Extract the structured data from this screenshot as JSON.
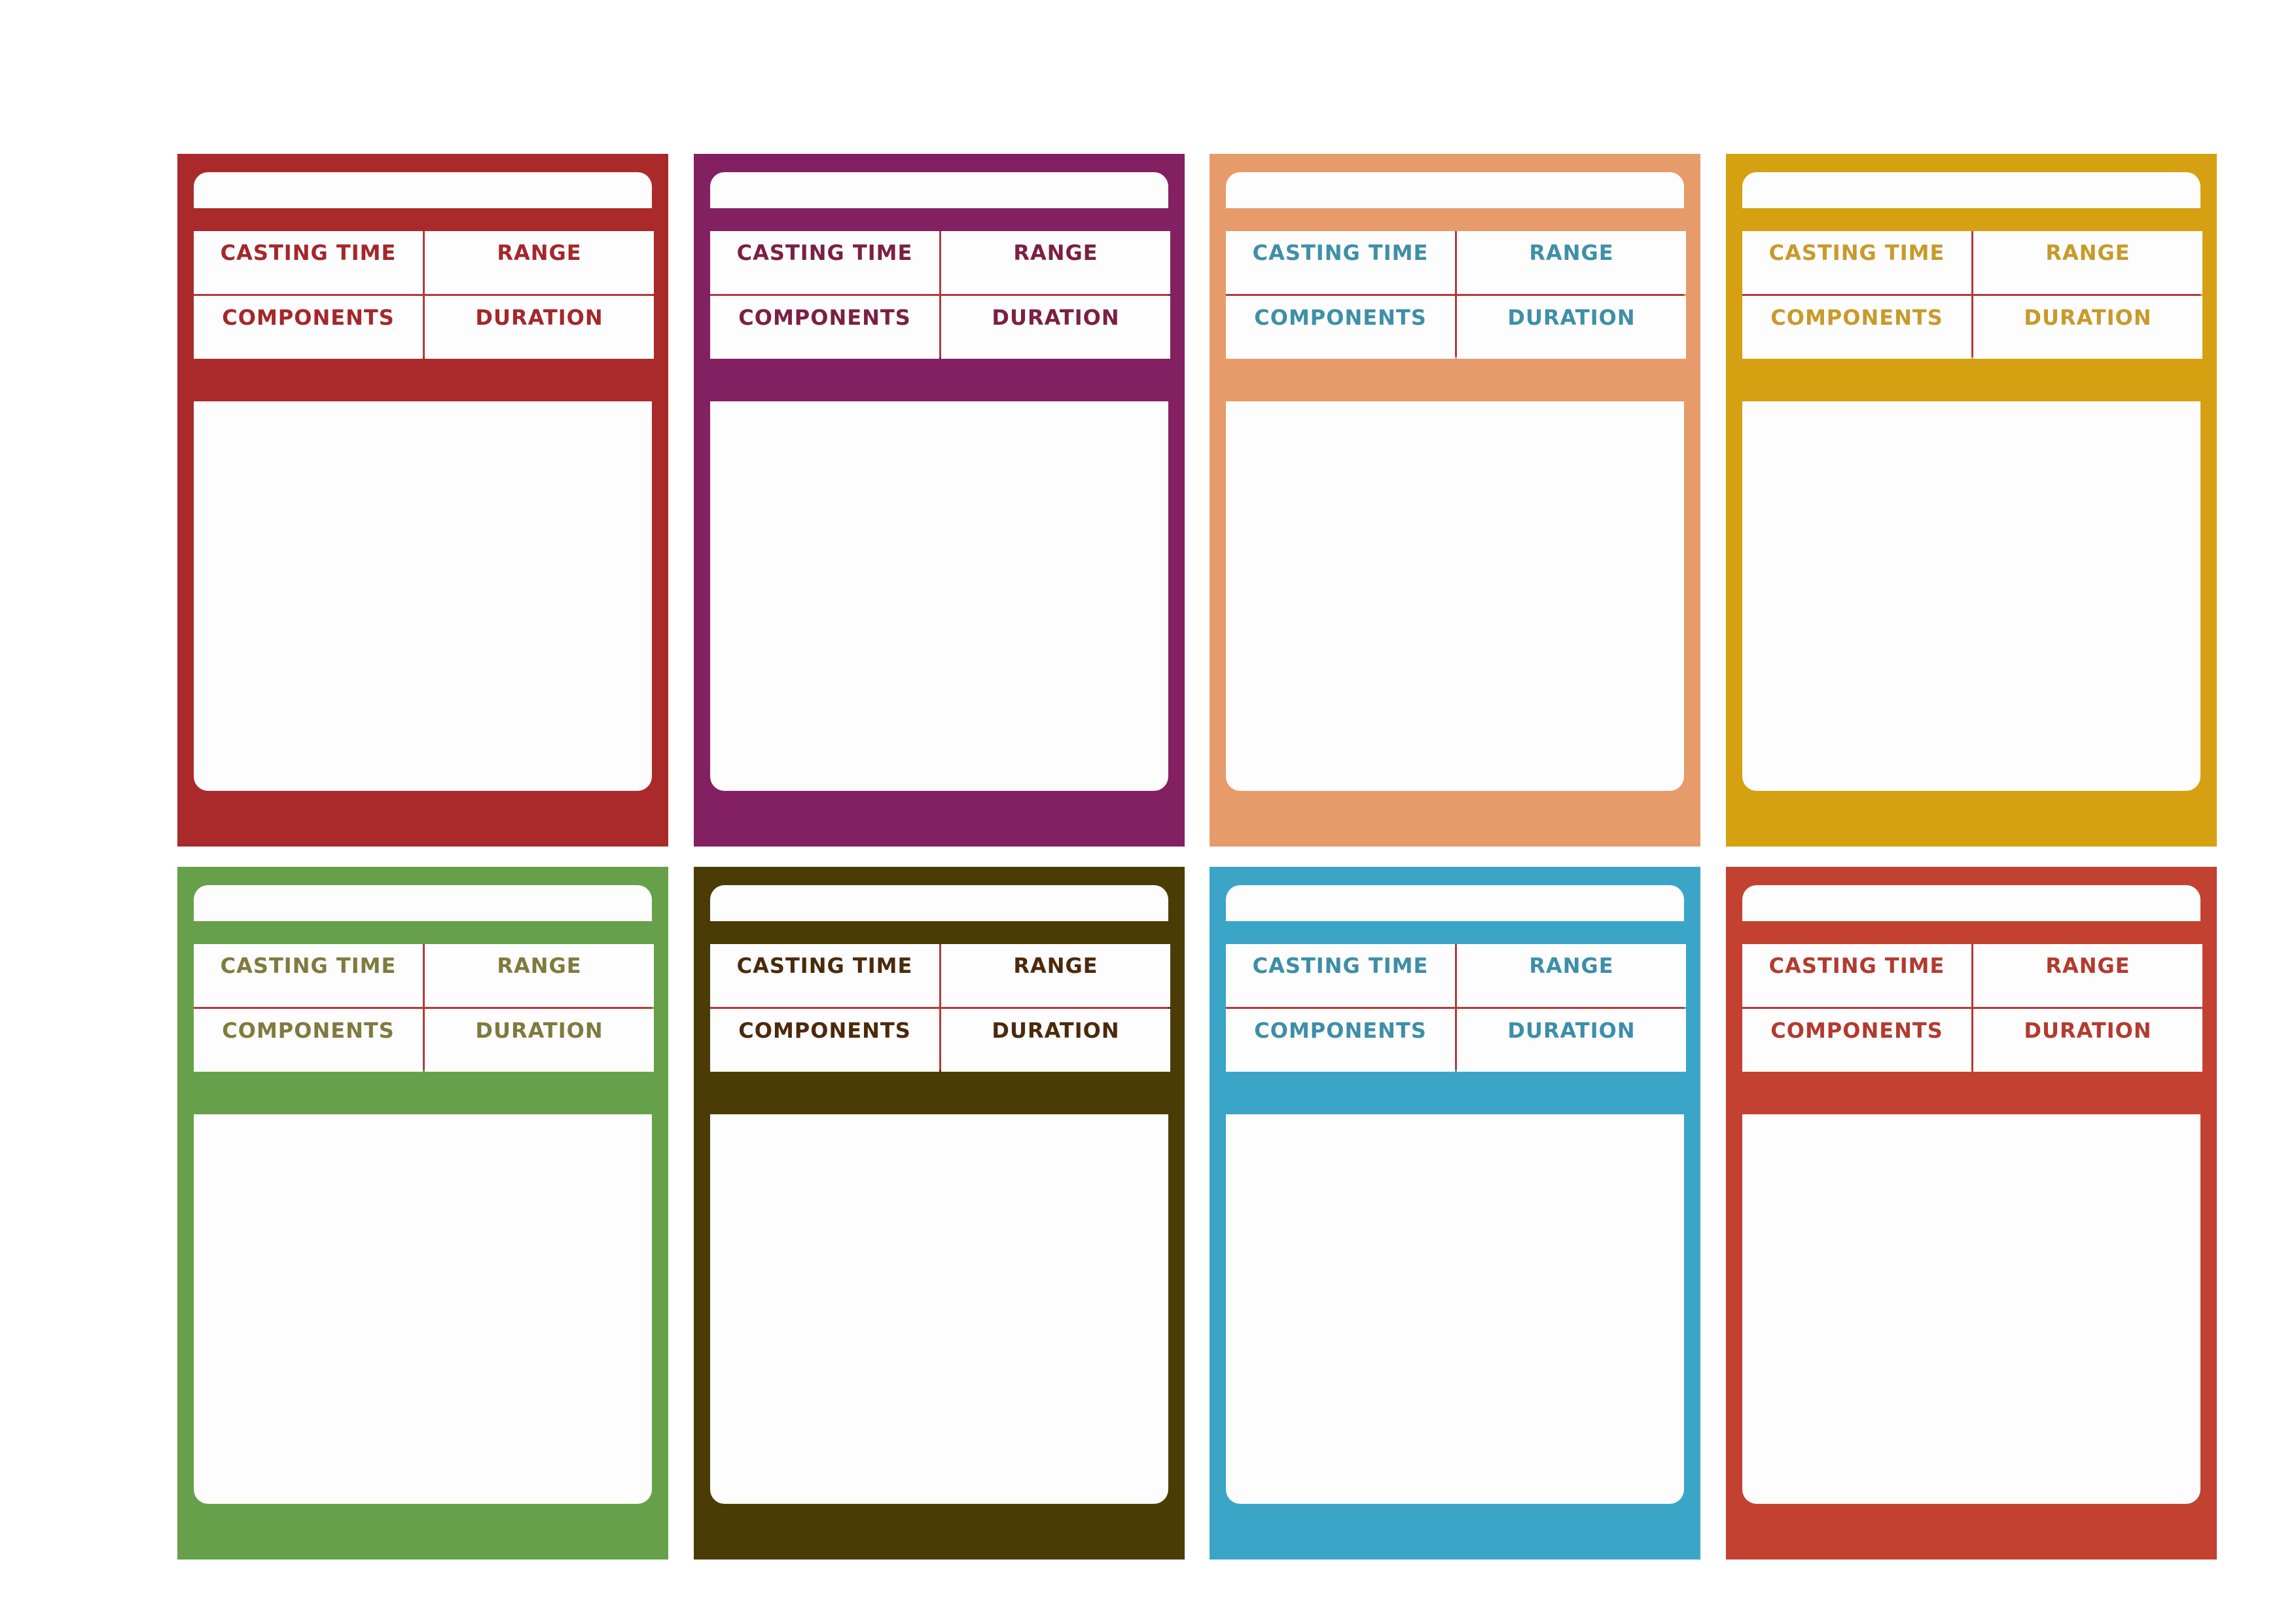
{
  "labels": {
    "casting_time": "CASTING TIME",
    "range": "RANGE",
    "components": "COMPONENTS",
    "duration": "DURATION"
  },
  "cards": [
    {
      "name": "card-red",
      "frame_color": "#aa2a2c",
      "label_color": "#a3272b"
    },
    {
      "name": "card-purple",
      "frame_color": "#822062",
      "label_color": "#7b2040"
    },
    {
      "name": "card-peach",
      "frame_color": "#e79b6b",
      "label_color": "#3f8fa8"
    },
    {
      "name": "card-gold",
      "frame_color": "#d5a112",
      "label_color": "#c79a2b"
    },
    {
      "name": "card-green",
      "frame_color": "#66a04a",
      "label_color": "#7f7a3e"
    },
    {
      "name": "card-brown",
      "frame_color": "#4a3c04",
      "label_color": "#4b2a0c"
    },
    {
      "name": "card-blue",
      "frame_color": "#3ba5c8",
      "label_color": "#3d8ea8"
    },
    {
      "name": "card-orange-red",
      "frame_color": "#c24131",
      "label_color": "#b23a2e"
    }
  ]
}
